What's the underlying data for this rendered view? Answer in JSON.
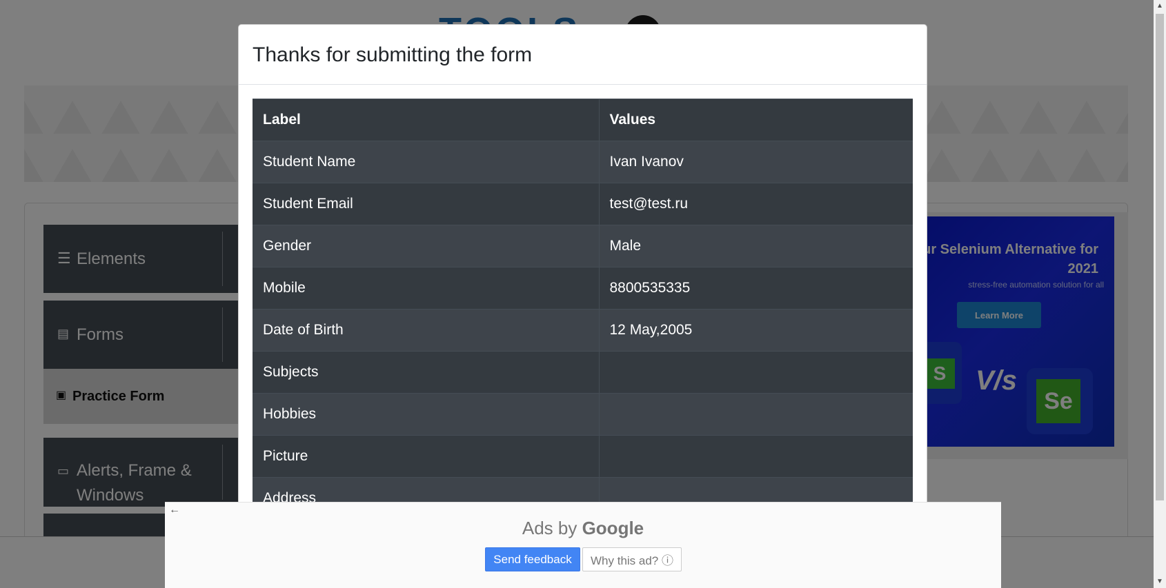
{
  "background": {
    "logo_text": "TOOLS",
    "sidebar": {
      "elements": "Elements",
      "forms": "Forms",
      "practice_form": "Practice Form",
      "alerts": "Alerts, Frame & Windows"
    },
    "ad": {
      "title": "ur Selenium Alternative for 2021",
      "subtitle": "stress-free automation solution for all",
      "button": "Learn More",
      "vs": "V/s",
      "left_logo": "S",
      "right_logo": "Se"
    }
  },
  "modal": {
    "title": "Thanks for submitting the form",
    "table": {
      "headers": [
        "Label",
        "Values"
      ],
      "rows": [
        {
          "label": "Student Name",
          "value": "Ivan Ivanov"
        },
        {
          "label": "Student Email",
          "value": "test@test.ru"
        },
        {
          "label": "Gender",
          "value": "Male"
        },
        {
          "label": "Mobile",
          "value": "8800535335"
        },
        {
          "label": "Date of Birth",
          "value": "12 May,2005"
        },
        {
          "label": "Subjects",
          "value": ""
        },
        {
          "label": "Hobbies",
          "value": ""
        },
        {
          "label": "Picture",
          "value": ""
        },
        {
          "label": "Address",
          "value": ""
        }
      ]
    }
  },
  "google_ad": {
    "label_prefix": "Ads by ",
    "label_brand": "Google",
    "send_feedback": "Send feedback",
    "why_this_ad": "Why this ad? ⓘ"
  },
  "colors": {
    "table_bg": "#343a40",
    "table_stripe": "#3e444b",
    "sidebar_bg": "#454d55",
    "feedback_blue": "#4285f4"
  }
}
